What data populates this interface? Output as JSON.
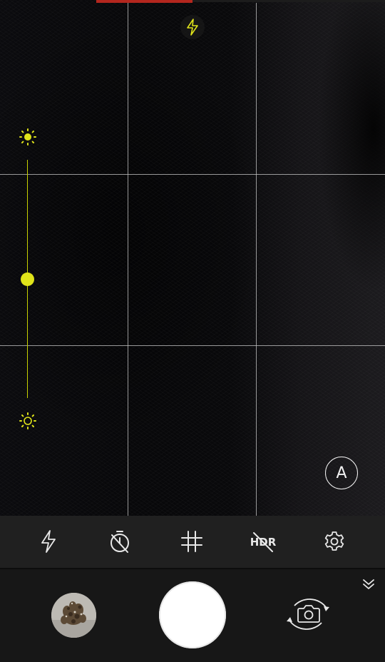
{
  "viewfinder": {
    "auto_label": "A"
  },
  "exposure_slider": {
    "level": 0.5
  },
  "toolbar": {
    "items": [
      {
        "icon": "flash-icon"
      },
      {
        "icon": "timer-off-icon"
      },
      {
        "icon": "grid-icon"
      },
      {
        "icon": "hdr-off-icon",
        "label": "HDR"
      },
      {
        "icon": "gear-icon"
      }
    ]
  },
  "colors": {
    "accent_yellow": "#dfe31a",
    "progress_red": "#b3261e",
    "toolbar_bg": "#202020",
    "bottom_bg": "#171717",
    "grid_line": "#c8c8c8"
  }
}
